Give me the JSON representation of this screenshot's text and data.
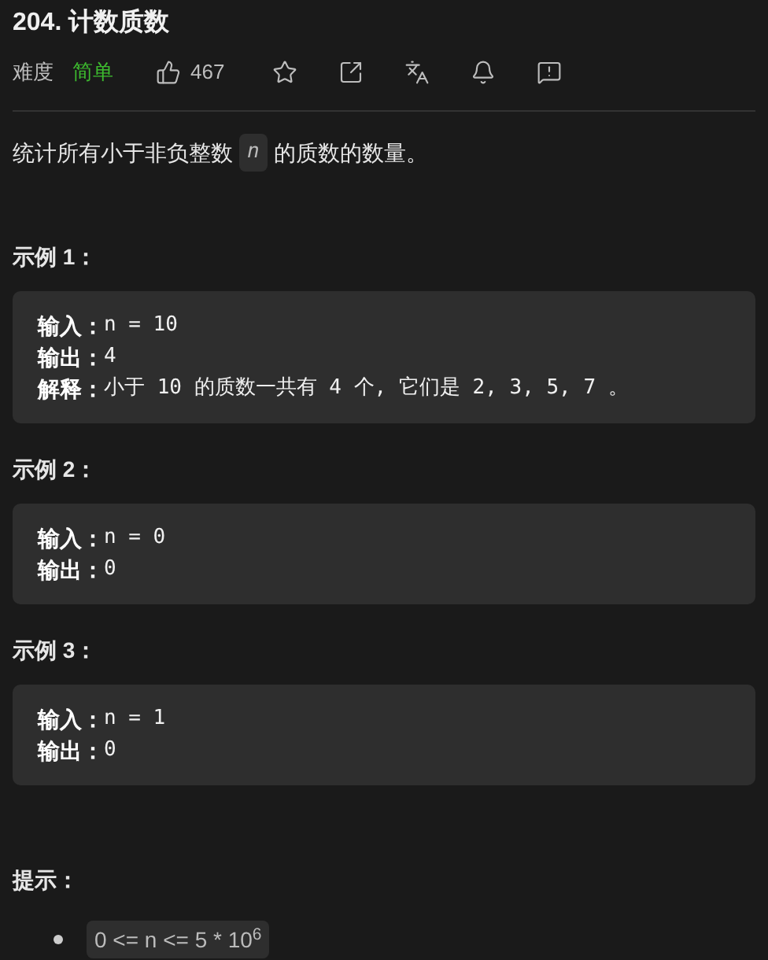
{
  "title": "204. 计数质数",
  "meta": {
    "difficulty_label": "难度",
    "difficulty": "简单",
    "likes": "467"
  },
  "description": {
    "before": "统计所有小于非负整数",
    "code": "n",
    "after": "的质数的数量。"
  },
  "examples": [
    {
      "heading": "示例 1：",
      "lines": [
        {
          "label": "输入：",
          "value": "n = 10"
        },
        {
          "label": "输出：",
          "value": "4"
        },
        {
          "label": "解释：",
          "value": "小于 10 的质数一共有 4 个, 它们是 2, 3, 5, 7 。"
        }
      ]
    },
    {
      "heading": "示例 2：",
      "lines": [
        {
          "label": "输入：",
          "value": "n = 0"
        },
        {
          "label": "输出：",
          "value": "0"
        }
      ]
    },
    {
      "heading": "示例 3：",
      "lines": [
        {
          "label": "输入：",
          "value": "n = 1"
        },
        {
          "label": "输出：",
          "value": "0"
        }
      ]
    }
  ],
  "hints": {
    "heading": "提示：",
    "items": [
      "0 <= n <= 5 * 10$^{6}$"
    ]
  }
}
